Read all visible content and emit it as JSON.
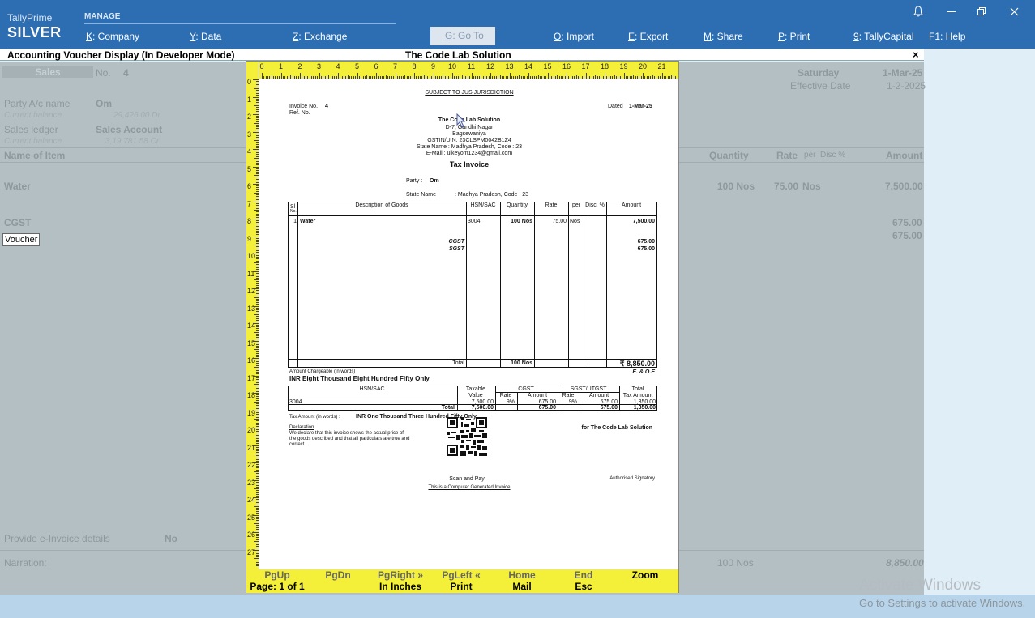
{
  "app": {
    "product": "TallyPrime",
    "edition": "SILVER",
    "menu_group": "MANAGE",
    "menu": [
      {
        "key": "K",
        "label": ": Company"
      },
      {
        "key": "Y",
        "label": ": Data"
      },
      {
        "key": "Z",
        "label": ": Exchange"
      },
      {
        "key": "G",
        "label": ": Go To"
      },
      {
        "key": "O",
        "label": ": Import"
      },
      {
        "key": "E",
        "label": ": Export"
      },
      {
        "key": "M",
        "label": ": Share"
      },
      {
        "key": "P",
        "label": ": Print"
      },
      {
        "key": "9",
        "label": ": TallyCapital"
      },
      {
        "key": "F1",
        "label": ": Help"
      }
    ]
  },
  "strip": {
    "title": "Accounting Voucher Display (In Developer Mode)",
    "company": "The Code Lab Solution",
    "close": "×"
  },
  "background": {
    "voucher_type": "Sales",
    "no_label": "No.",
    "no_value": "4",
    "day": "Saturday",
    "date": "1-Mar-25",
    "effective_date_label": "Effective Date",
    "effective_date": "1-2-2025",
    "party_label": "Party A/c name",
    "party_value": "Om",
    "current_balance_label": "Current balance",
    "party_balance": "29,426.00 Dr",
    "sales_ledger_label": "Sales ledger",
    "sales_ledger_value": "Sales Account",
    "sales_balance": "3,19,781.58 Cr",
    "col_item": "Name of Item",
    "col_qty": "Quantity",
    "col_rate": "Rate",
    "col_per": "per",
    "col_disc": "Disc %",
    "col_amount": "Amount",
    "item": "Water",
    "item_qty": "100 Nos",
    "item_rate": "75.00",
    "item_per": "Nos",
    "item_amount": "7,500.00",
    "cgst": "CGST",
    "cgst_amount": "675.00",
    "sgst_amount": "675.00",
    "tooltip": "Voucher",
    "einvoice_label": "Provide e-Invoice details",
    "einvoice_value": "No",
    "narration_label": "Narration:",
    "total_qty": "100 Nos",
    "total_amount": "8,850.00"
  },
  "invoice": {
    "jurisdiction": "SUBJECT TO JUS JURISDICTION",
    "invoice_no_label": "Invoice No.",
    "invoice_no": "4",
    "ref_no_label": "Ref. No.",
    "dated_label": "Dated",
    "dated": "1-Mar-25",
    "company": "The Code Lab Solution",
    "address1": "D-7, Gandhi Nagar",
    "address2": "Bagsewaniya",
    "gstin": "GSTIN/UIN: 23CLSPM0042B1Z4",
    "state": "State Name :  Madhya Pradesh, Code : 23",
    "email": "E-Mail : uikeyom1234@gmail.com",
    "doc_title": "Tax Invoice",
    "party_label": "Party :",
    "party": "Om",
    "party_state_label": "State Name",
    "party_state": ":  Madhya Pradesh, Code : 23",
    "cols": {
      "sl": "Sl",
      "no": "No.",
      "desc": "Description of Goods",
      "hsn": "HSN/SAC",
      "qty": "Quantity",
      "rate": "Rate",
      "per": "per",
      "disc": "Disc. %",
      "amount": "Amount"
    },
    "row": {
      "sl": "1",
      "desc": "Water",
      "hsn": "3004",
      "qty": "100 Nos",
      "rate": "75.00",
      "per": "Nos",
      "amount": "7,500.00"
    },
    "tax1_label": "CGST",
    "tax1_amount": "675.00",
    "tax2_label": "SGST",
    "tax2_amount": "675.00",
    "total_label": "Total",
    "total_qty": "100 Nos",
    "total_amount": "₹ 8,850.00",
    "words_label": "Amount Chargeable (in words)",
    "eoe": "E. & O.E",
    "words": "INR Eight Thousand Eight Hundred Fifty Only",
    "tax_table": {
      "hsn": "HSN/SAC",
      "taxable1": "Taxable",
      "taxable2": "Value",
      "cgst": "CGST",
      "sgst": "SGST/UTGST",
      "total1": "Total",
      "total2": "Tax Amount",
      "rate": "Rate",
      "amount": "Amount",
      "row_hsn": "3004",
      "row_value": "7,500.00",
      "row_cgst_rate": "9%",
      "row_cgst_amt": "675.00",
      "row_sgst_rate": "9%",
      "row_sgst_amt": "675.00",
      "row_total": "1,350.00",
      "tot_label": "Total",
      "tot_value": "7,500.00",
      "tot_cgst": "675.00",
      "tot_sgst": "675.00",
      "tot_total": "1,350.00"
    },
    "tax_words_label": "Tax Amount (in words)  :",
    "tax_words": "INR One Thousand Three Hundred Fifty Only",
    "declaration_label": "Declaration",
    "declaration1": "We declare that this invoice shows the actual price of",
    "declaration2": "the goods described and that all particulars are true and",
    "declaration3": "correct.",
    "for_company": "for The Code Lab Solution",
    "scan_pay": "Scan and Pay",
    "signatory": "Authorised Signatory",
    "computer_generated": "This is a Computer Generated Invoice"
  },
  "function_bar": {
    "pgup": "PgUp",
    "pgdn": "PgDn",
    "pgright": "PgRight »",
    "pgleft": "PgLeft «",
    "home": "Home",
    "end": "End",
    "zoom": "Zoom",
    "page": "Page: 1 of 1",
    "inches": "In Inches",
    "print": "Print",
    "mail": "Mail",
    "esc": "Esc"
  },
  "watermark": {
    "line1": "Activate Windows",
    "line2": "Go to Settings to activate Windows."
  },
  "colors": {
    "header": "#2d6db1",
    "ruler": "#f4f03a",
    "dim": "#b4bfc3"
  }
}
